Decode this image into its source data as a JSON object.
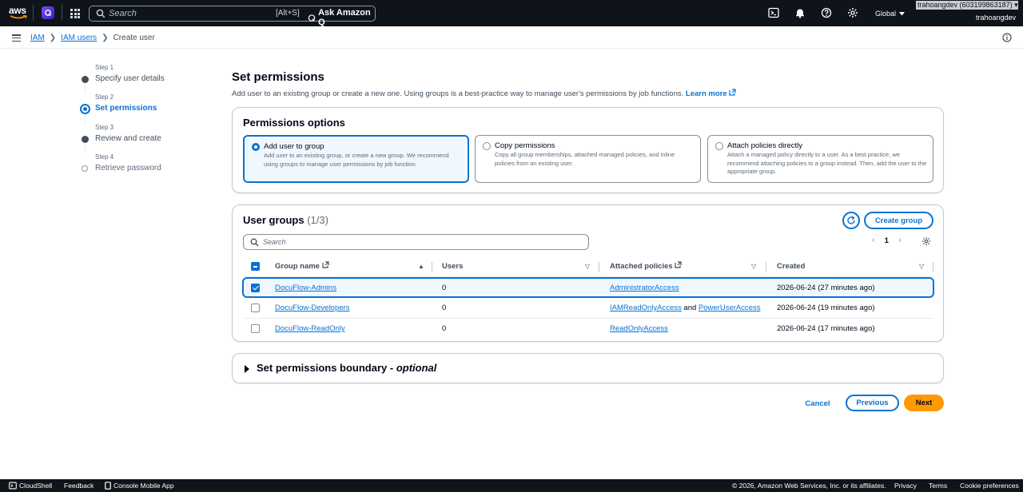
{
  "topnav": {
    "logo_text": "aws",
    "search_placeholder": "Search",
    "search_shortcut": "[Alt+S]",
    "ask_q": "Ask Amazon Q",
    "region": "Global",
    "account": "trahoangdev (603199863187)",
    "username": "trahoangdev"
  },
  "breadcrumb": {
    "items": [
      "IAM",
      "IAM users",
      "Create user"
    ]
  },
  "steps": [
    {
      "label": "Step 1",
      "name": "Specify user details",
      "state": "complete"
    },
    {
      "label": "Step 2",
      "name": "Set permissions",
      "state": "active"
    },
    {
      "label": "Step 3",
      "name": "Review and create",
      "state": "complete"
    },
    {
      "label": "Step 4",
      "name": "Retrieve password",
      "state": "pending"
    }
  ],
  "page": {
    "title": "Set permissions",
    "description": "Add user to an existing group or create a new one. Using groups is a best-practice way to manage user's permissions by job functions.",
    "learn_more": "Learn more"
  },
  "permissions_options": {
    "title": "Permissions options",
    "options": [
      {
        "title": "Add user to group",
        "desc": "Add user to an existing group, or create a new group. We recommend using groups to manage user permissions by job function.",
        "selected": true
      },
      {
        "title": "Copy permissions",
        "desc": "Copy all group memberships, attached managed policies, and inline policies from an existing user.",
        "selected": false
      },
      {
        "title": "Attach policies directly",
        "desc": "Attach a managed policy directly to a user. As a best practice, we recommend attaching policies to a group instead. Then, add the user to the appropriate group.",
        "selected": false
      }
    ]
  },
  "user_groups": {
    "title": "User groups",
    "count": "(1/3)",
    "create_button": "Create group",
    "search_placeholder": "Search",
    "page": "1",
    "columns": [
      "Group name",
      "Users",
      "Attached policies",
      "Created"
    ],
    "rows": [
      {
        "name": "DocuFlow-Admins",
        "users": "0",
        "policies": [
          "AdministratorAccess"
        ],
        "created": "2026-06-24 (27 minutes ago)",
        "selected": true
      },
      {
        "name": "DocuFlow-Developers",
        "users": "0",
        "policies": [
          "IAMReadOnlyAccess",
          "PowerUserAccess"
        ],
        "policy_joiner": "and",
        "created": "2026-06-24 (19 minutes ago)",
        "selected": false
      },
      {
        "name": "DocuFlow-ReadOnly",
        "users": "0",
        "policies": [
          "ReadOnlyAccess"
        ],
        "created": "2026-06-24 (17 minutes ago)",
        "selected": false
      }
    ]
  },
  "boundary": {
    "title": "Set permissions boundary - ",
    "optional": "optional"
  },
  "actions": {
    "cancel": "Cancel",
    "previous": "Previous",
    "next": "Next"
  },
  "footer": {
    "cloudshell": "CloudShell",
    "feedback": "Feedback",
    "mobile": "Console Mobile App",
    "copyright": "© 2026, Amazon Web Services, Inc. or its affiliates.",
    "privacy": "Privacy",
    "terms": "Terms",
    "cookies": "Cookie preferences"
  },
  "colors": {
    "accent": "#0972d3",
    "primary_button": "#ff9900",
    "topnav_bg": "#0f141a"
  }
}
